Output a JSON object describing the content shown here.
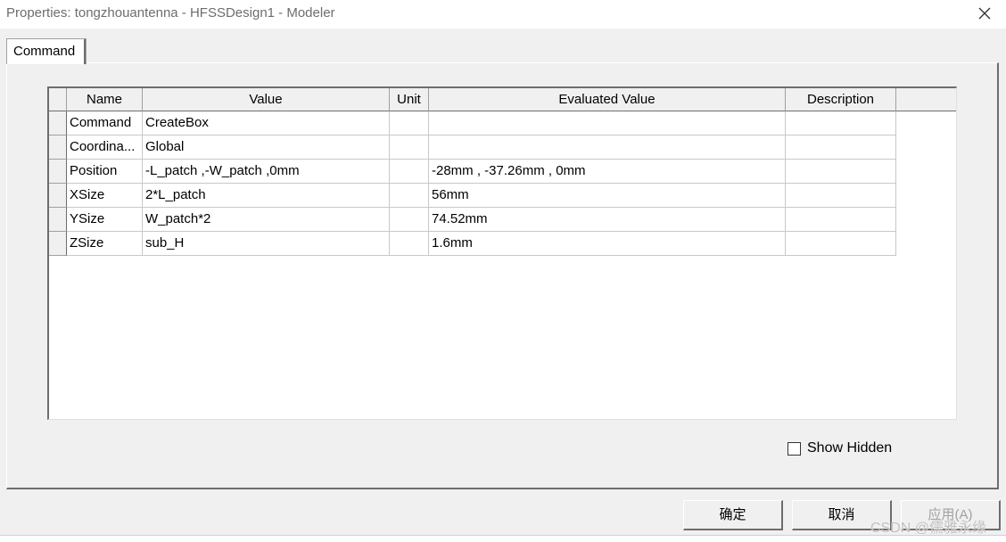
{
  "window": {
    "title": "Properties: tongzhouantenna - HFSSDesign1 - Modeler"
  },
  "tabs": [
    {
      "label": "Command"
    }
  ],
  "grid": {
    "columns": [
      "Name",
      "Value",
      "Unit",
      "Evaluated Value",
      "Description"
    ],
    "rows": [
      {
        "name": "Command",
        "value": "CreateBox",
        "unit": "",
        "evaluated": "",
        "description": ""
      },
      {
        "name": "Coordina...",
        "value": "Global",
        "unit": "",
        "evaluated": "",
        "description": ""
      },
      {
        "name": "Position",
        "value": "-L_patch ,-W_patch ,0mm",
        "unit": "",
        "evaluated": "-28mm , -37.26mm , 0mm",
        "description": ""
      },
      {
        "name": "XSize",
        "value": "2*L_patch",
        "unit": "",
        "evaluated": "56mm",
        "description": ""
      },
      {
        "name": "YSize",
        "value": "W_patch*2",
        "unit": "",
        "evaluated": "74.52mm",
        "description": ""
      },
      {
        "name": "ZSize",
        "value": "sub_H",
        "unit": "",
        "evaluated": "1.6mm",
        "description": ""
      }
    ]
  },
  "show_hidden": {
    "label": "Show Hidden",
    "checked": false
  },
  "buttons": {
    "ok": "确定",
    "cancel": "取消",
    "apply": "应用(A)"
  },
  "watermark": "CSDN @儒雅永缘"
}
